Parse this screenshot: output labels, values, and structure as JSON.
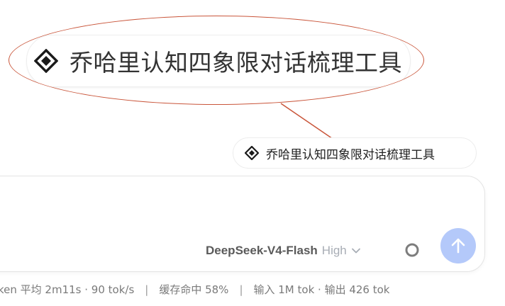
{
  "tool_chip": {
    "label": "乔哈里认知四象限对话梳理工具",
    "icon": "diamond-icon"
  },
  "composer": {
    "model_name": "DeepSeek-V4-Flash",
    "effort_level": "High",
    "chevron_icon": "chevron-down-icon",
    "circle_icon": "circle-icon",
    "send_icon": "arrow-up-icon",
    "send_button_color": "#b4c9fa"
  },
  "status": {
    "timing": "ken 平均 2m11s · 90 tok/s",
    "cache": "缓存命中 58%",
    "tokens": "输入 1M tok · 输出 426 tok",
    "separator": "|"
  },
  "colors": {
    "callout_outline": "#c9553a"
  }
}
